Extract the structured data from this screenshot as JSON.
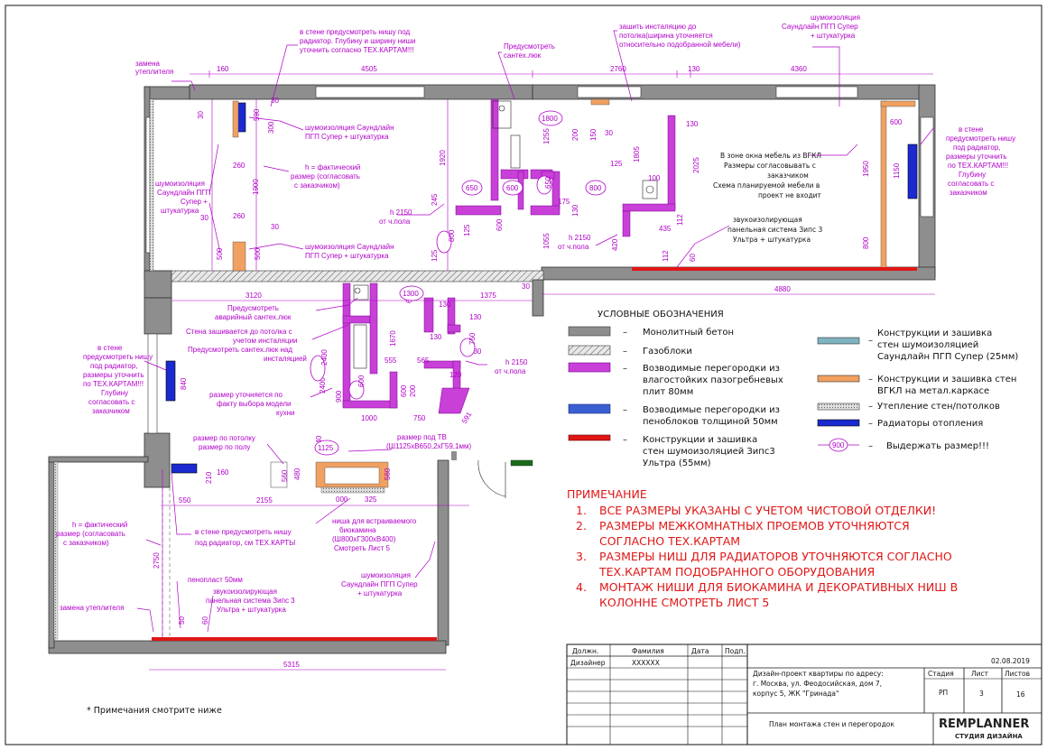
{
  "dims": {
    "top": [
      "160",
      "4505",
      "2760",
      "130",
      "4360"
    ],
    "d30": "30",
    "d590": "590",
    "d300": "300",
    "d260": "260",
    "d500": "500",
    "d1900": "1900",
    "d1920": "1920",
    "d3120": "3120",
    "d1375": "1375",
    "d4880": "4880",
    "d5315": "5315",
    "d2750": "2750",
    "d2155": "2155",
    "d550": "550",
    "d1255": "1255",
    "d1055": "1055",
    "d2025": "2025",
    "d1805": "1805",
    "d1950": "1950",
    "d800": "800",
    "d1800": "1800",
    "d1670": "1670",
    "d2400": "2400",
    "d1000": "1000",
    "d750": "750",
    "d940": "940",
    "d840": "840",
    "d1150": "1150",
    "d600": "600",
    "d650": "650",
    "d245": "245",
    "d125": "125",
    "d130": "130",
    "d1125": "1125",
    "d1300": "1300",
    "d000": "000",
    "d325": "325",
    "d560": "560",
    "d480": "480",
    "d160b": "160",
    "d200": "200",
    "d150": "150",
    "d100": "100",
    "d555": "555",
    "d565": "565",
    "d1000b": "1000",
    "d435": "435",
    "d112": "112",
    "d60": "60",
    "d50": "50",
    "d120": "120",
    "d175": "175",
    "d420": "420",
    "d640": "640",
    "d591": "591",
    "d210": "210",
    "d900": "900"
  },
  "notes_magenta": {
    "replace_insulation_top": [
      "замена",
      "утеплителя"
    ],
    "niche_radiator_top": [
      "в стене предусмотреть нишу под",
      "радиатор. Глубину и ширину ниши",
      "уточнить согласно ТЕХ.КАРТАМ!!!"
    ],
    "sewer": [
      "Предусмотреть",
      "сантех.люк"
    ],
    "sew_pipes": [
      "зашить инсталяцию до",
      "потолка(ширина уточняется",
      "относительно подобранной мебели)"
    ],
    "soundproof_top_right": [
      "шумоизоляция",
      "Саундлайн ПГП Супер",
      "+ штукатурка"
    ],
    "soundproof_mid1": [
      "шумоизоляция Саундлайн",
      "ПГП Супер + штукатурка"
    ],
    "h_actual_top": [
      "h = фактический",
      "размер (согласовать",
      "с заказчиком)"
    ],
    "soundproof_left": [
      "шумоизоляция",
      "Саундлайн ПГП",
      "Супер +",
      "штукатурка"
    ],
    "h2150_a": [
      "h 2150",
      "от ч.пола"
    ],
    "soundproof_mid2": [
      "шумоизоляция Саундлайн",
      "ПГП Супер + штукатурка"
    ],
    "h2150_b": [
      "h 2150",
      "от ч.пола"
    ],
    "window_zone": [
      "В зоне окна мебель из ВГКЛ",
      "Размеры согласовывать с",
      "заказчиком",
      "Схема планируемой мебели в",
      "проект не входит"
    ],
    "sound_panel_top": [
      "звукоизолирующая",
      "панельная система Зипс 3",
      "Ультра + штукатурка"
    ],
    "niche_right": [
      "в стене",
      "предусмотреть нишу",
      "под радиатор,",
      "размеры уточнить",
      "по ТЕХ.КАРТАМ!!!",
      "Глубину",
      "согласовать с",
      "заказчиком"
    ],
    "emergency_hatch": [
      "Предусмотреть",
      "аварийный сантех.люк"
    ],
    "wall_sewn": [
      "Стена зашивается до потолка с",
      "учетом инсталяции",
      "Предусмотреть сантех.люк над",
      "инсталяцией"
    ],
    "niche_left": [
      "в стене",
      "предусмотреть нишу",
      "под радиатор,",
      "размеры уточнить",
      "по ТЕХ.КАРТАМ!!!",
      "Глубину",
      "согласовать с",
      "заказчиком"
    ],
    "size_kitchen": [
      "размер уточняется по",
      "факту выбора модели",
      "кухни"
    ],
    "h2150_c": [
      "h 2150",
      "от ч.пола"
    ],
    "size_floor": [
      "размер по потолку",
      "размер по полу"
    ],
    "tv_niche": [
      "размер под ТВ",
      "(Ш1125хВ650,2хГ59,1мм)"
    ],
    "niche_radiator_bottom": [
      "в стене предусмотреть нишу",
      "под радиатор, см ТЕХ.КАРТЫ"
    ],
    "biofire": [
      "ниша для встраиваемого",
      "биокамина",
      "(Ш800хГ300хВ400)",
      "Смотреть Лист 5"
    ],
    "h_actual_bottom": [
      "h = фактический",
      "размер (согласовать",
      "с заказчиком)"
    ],
    "foam50": "пенопласт 50мм",
    "sound_panel_bottom": [
      "звукоизолирующая",
      "панельная система Зипс 3",
      "Ультра + штукатурка"
    ],
    "soundproof_bottom": [
      "шумоизоляция",
      "Саундлайн ПГП Супер",
      "+ штукатурка"
    ],
    "replace_insulation_bottom": "замена утеплителя"
  },
  "legend": {
    "title": "УСЛОВНЫЕ ОБОЗНАЧЕНИЯ",
    "dash": "–",
    "items_left": [
      {
        "lines": [
          "Монолитный бетон"
        ]
      },
      {
        "lines": [
          "Газоблоки"
        ]
      },
      {
        "lines": [
          "Возводимые перегородки из",
          "влагостойких пазогребневых",
          "плит 80мм"
        ]
      },
      {
        "lines": [
          "Возводимые перегородки из",
          "пеноблоков толщиной 50мм"
        ]
      },
      {
        "lines": [
          "Конструкции и зашивка",
          "стен шумоизоляцией Зипс3",
          "Ультра (55мм)"
        ]
      }
    ],
    "items_right": [
      {
        "lines": [
          "Конструкции и зашивка",
          "стен шумоизоляцией",
          "Саундлайн ПГП Супер (25мм)"
        ]
      },
      {
        "lines": [
          "Конструкции и зашивка стен",
          "ВГКЛ на метал.каркасе"
        ]
      },
      {
        "lines": [
          "Утепление стен/потолков"
        ]
      },
      {
        "lines": [
          "Радиаторы отопления"
        ]
      },
      {
        "lines": [
          "Выдержать размер!!!"
        ]
      }
    ],
    "keep_symbol": "900",
    "colors": {
      "concrete": "#8e8e8e",
      "partition_pgp": "#c840d8",
      "partition_foam": "#3a5fd0",
      "zips": "#e01616",
      "soundline": "#7fb3bf",
      "vgkl": "#f0a060",
      "insulation": "#c8c8c8",
      "radiator": "#1a2ad0"
    }
  },
  "remarks": {
    "title": "ПРИМЕЧАНИЕ",
    "items": [
      {
        "num": "1.",
        "lines": [
          "ВСЕ РАЗМЕРЫ УКАЗАНЫ С УЧЕТОМ ЧИСТОВОЙ ОТДЕЛКИ!"
        ]
      },
      {
        "num": "2.",
        "lines": [
          "РАЗМЕРЫ МЕЖКОМНАТНЫХ ПРОЕМОВ УТОЧНЯЮТСЯ",
          "СОГЛАСНО ТЕХ.КАРТАМ"
        ]
      },
      {
        "num": "3.",
        "lines": [
          "РАЗМЕРЫ НИШ ДЛЯ РАДИАТОРОВ УТОЧНЯЮТСЯ СОГЛАСНО",
          "ТЕХ.КАРТАМ ПОДОБРАННОГО ОБОРУДОВАНИЯ"
        ]
      },
      {
        "num": "4.",
        "lines": [
          "МОНТАЖ НИШИ ДЛЯ БИОКАМИНА И ДЕКОРАТИВНЫХ НИШ В",
          "КОЛОННЕ СМОТРЕТЬ ЛИСТ 5"
        ]
      }
    ]
  },
  "footnote": "* Примечания смотрите ниже",
  "title_block": {
    "headers": [
      "Должн.",
      "Фамилия",
      "Дата",
      "Подп."
    ],
    "designer_role": "Дизайнер",
    "designer_name": "ХХХХХХ",
    "date": "02.08.2019",
    "project_lines": [
      "Дизайн-проект квартиры по адресу:",
      "г. Москва, ул. Феодосийская, дом 7,",
      "корпус 5, ЖК \"Гринада\""
    ],
    "stage_label": "Стадия",
    "sheet_label": "Лист",
    "sheets_label": "Листов",
    "stage": "РП",
    "sheet": "3",
    "sheets": "16",
    "drawing_name": "План монтажа стен и перегородок",
    "logo_main": "REMPLANNER",
    "logo_sub": "СТУДИЯ ДИЗАЙНА"
  }
}
